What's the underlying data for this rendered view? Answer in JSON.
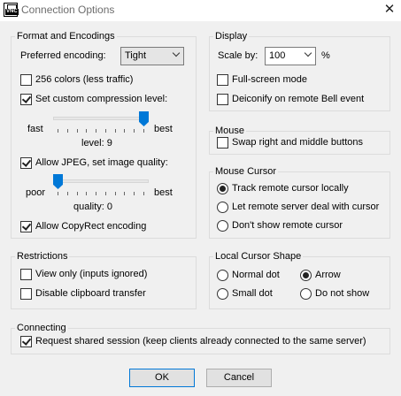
{
  "window": {
    "title": "Connection Options",
    "app_icon_text": "VNC",
    "close_glyph": "✕"
  },
  "format": {
    "legend": "Format and Encodings",
    "preferred_encoding_label": "Preferred encoding:",
    "preferred_encoding_value": "Tight",
    "colors_256": {
      "label": "256 colors (less traffic)",
      "checked": false
    },
    "custom_compression": {
      "label": "Set custom compression level:",
      "checked": true
    },
    "compression_slider": {
      "min_label": "fast",
      "max_label": "best",
      "value_text": "level: 9",
      "value": 9,
      "min": 0,
      "max": 9
    },
    "allow_jpeg": {
      "label": "Allow JPEG, set image quality:",
      "checked": true
    },
    "quality_slider": {
      "min_label": "poor",
      "max_label": "best",
      "value_text": "quality: 0",
      "value": 0,
      "min": 0,
      "max": 9
    },
    "copyrect": {
      "label": "Allow CopyRect encoding",
      "checked": true
    }
  },
  "display": {
    "legend": "Display",
    "scale_label": "Scale by:",
    "scale_value": "100",
    "scale_unit": "%",
    "fullscreen": {
      "label": "Full-screen mode",
      "checked": false
    },
    "deiconify": {
      "label": "Deiconify on remote Bell event",
      "checked": false
    }
  },
  "mouse": {
    "legend": "Mouse",
    "swap_buttons": {
      "label": "Swap right and middle buttons",
      "checked": false
    }
  },
  "mouse_cursor": {
    "legend": "Mouse Cursor",
    "options": [
      {
        "label": "Track remote cursor locally",
        "checked": true
      },
      {
        "label": "Let remote server deal with cursor",
        "checked": false
      },
      {
        "label": "Don't show remote cursor",
        "checked": false
      }
    ]
  },
  "restrictions": {
    "legend": "Restrictions",
    "view_only": {
      "label": "View only (inputs ignored)",
      "checked": false
    },
    "disable_clipboard": {
      "label": "Disable clipboard transfer",
      "checked": false
    }
  },
  "local_cursor": {
    "legend": "Local Cursor Shape",
    "options": [
      {
        "label": "Normal dot",
        "checked": false
      },
      {
        "label": "Arrow",
        "checked": true
      },
      {
        "label": "Small dot",
        "checked": false
      },
      {
        "label": "Do not show",
        "checked": false
      }
    ]
  },
  "connecting": {
    "legend": "Connecting",
    "shared": {
      "label": "Request shared session (keep clients already connected to the same server)",
      "checked": true
    }
  },
  "buttons": {
    "ok": "OK",
    "cancel": "Cancel"
  }
}
